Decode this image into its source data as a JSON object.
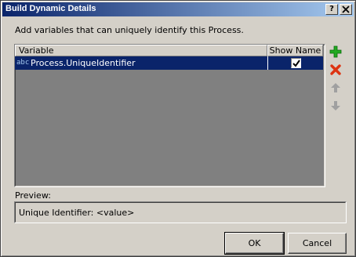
{
  "window": {
    "title": "Build Dynamic Details",
    "help_label": "?",
    "close_label": "✕"
  },
  "instruction": "Add variables that can uniquely identify this Process.",
  "table": {
    "columns": [
      "Variable",
      "Show Name"
    ],
    "rows": [
      {
        "icon": "abc",
        "variable": "Process.UniqueIdentifier",
        "show_name": true,
        "selected": true
      }
    ]
  },
  "side_buttons": {
    "add": "add-icon",
    "delete": "delete-icon",
    "move_up": "arrow-up-icon",
    "move_down": "arrow-down-icon"
  },
  "preview": {
    "label": "Preview:",
    "text": "Unique Identifier: <value>"
  },
  "buttons": {
    "ok": "OK",
    "cancel": "Cancel"
  },
  "colors": {
    "selection": "#0a246a",
    "add": "#22aa22",
    "delete": "#dd3311",
    "disabled_arrow": "#a0a0a0"
  }
}
